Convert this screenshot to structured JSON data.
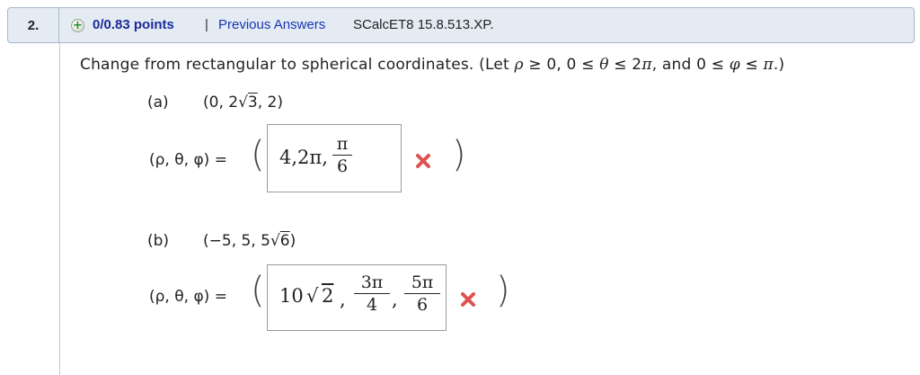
{
  "header": {
    "question_number": "2.",
    "points": "0/0.83 points",
    "separator": "|",
    "previous_answers": "Previous Answers",
    "source": "SCalcET8 15.8.513.XP."
  },
  "prompt": {
    "text_before": "Change from rectangular to spherical coordinates. (Let ",
    "rho": "ρ",
    "c1": " ≥ 0, 0 ≤ ",
    "theta": "θ",
    "c2": " ≤ 2",
    "pi1": "π",
    "c3": ", and 0 ≤ ",
    "phi": "φ",
    "c4": " ≤ ",
    "pi2": "π",
    "c5": ".)"
  },
  "parts": {
    "a": {
      "label": "(a)",
      "point_pre": "(0, 2",
      "point_sqrt": "√",
      "point_rad": "3",
      "point_post": ", 2)",
      "answer_label": "(ρ, θ, φ) =",
      "open_paren": "(",
      "close_paren": ")",
      "answer_prefix": "4,2π,",
      "answer_num": "π",
      "answer_den": "6",
      "status": "incorrect"
    },
    "b": {
      "label": "(b)",
      "point_pre": "(−5, 5, 5",
      "point_sqrt": "√",
      "point_rad": "6",
      "point_post": ")",
      "answer_label": "(ρ, θ, φ) =",
      "open_paren": "(",
      "close_paren": ")",
      "answer_prefix": "10",
      "answer_sqrt": "√",
      "answer_rad": "2",
      "comma1": ",",
      "frac1_num": "3π",
      "frac1_den": "4",
      "comma2": ",",
      "frac2_num": "5π",
      "frac2_den": "6",
      "status": "incorrect"
    }
  },
  "icons": {
    "plus": "+",
    "incorrect": "x-mark-icon"
  },
  "colors": {
    "header_bg": "#e4ebf3",
    "points": "#1a2c99",
    "link": "#1a35b5",
    "incorrect": "#e05252"
  }
}
